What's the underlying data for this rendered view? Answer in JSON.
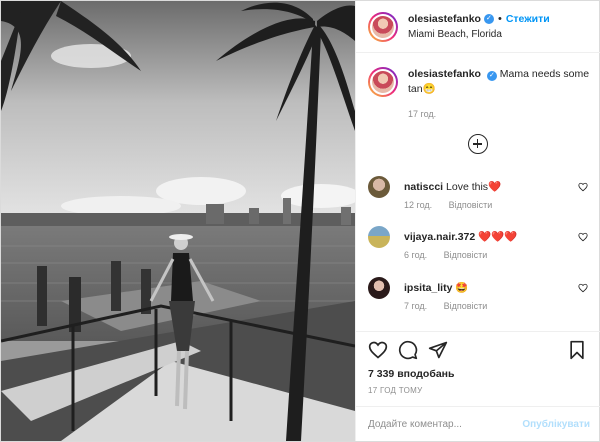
{
  "header": {
    "username": "olesiastefanko",
    "separator": "•",
    "follow_label": "Стежити",
    "location": "Miami Beach, Florida"
  },
  "caption": {
    "username": "olesiastefanko",
    "text": "Mama needs some tan😁",
    "time": "17 год."
  },
  "load_more_icon": "plus-circle-icon",
  "comments": [
    {
      "username": "natiscci",
      "text": "Love this❤️",
      "time": "12 год.",
      "reply_label": "Відповісти"
    },
    {
      "username": "vijaya.nair.372",
      "text": "❤️❤️❤️",
      "time": "6 год.",
      "reply_label": "Відповісти"
    },
    {
      "username": "ipsita_lity",
      "text": "🤩",
      "time": "7 год.",
      "reply_label": "Відповісти"
    }
  ],
  "actions": {
    "icons": [
      "heart-icon",
      "comment-icon",
      "share-icon",
      "bookmark-icon"
    ],
    "likes": "7 339 вподобань",
    "posted_ago": "17 ГОД ТОМУ"
  },
  "add_comment": {
    "placeholder": "Додайте коментар...",
    "post_label": "Опублікувати"
  },
  "colors": {
    "accent": "#0095f6",
    "verified": "#3897f0",
    "heart_red": "#ed4956",
    "muted": "#8e8e8e",
    "post_disabled": "#b2dffc"
  }
}
